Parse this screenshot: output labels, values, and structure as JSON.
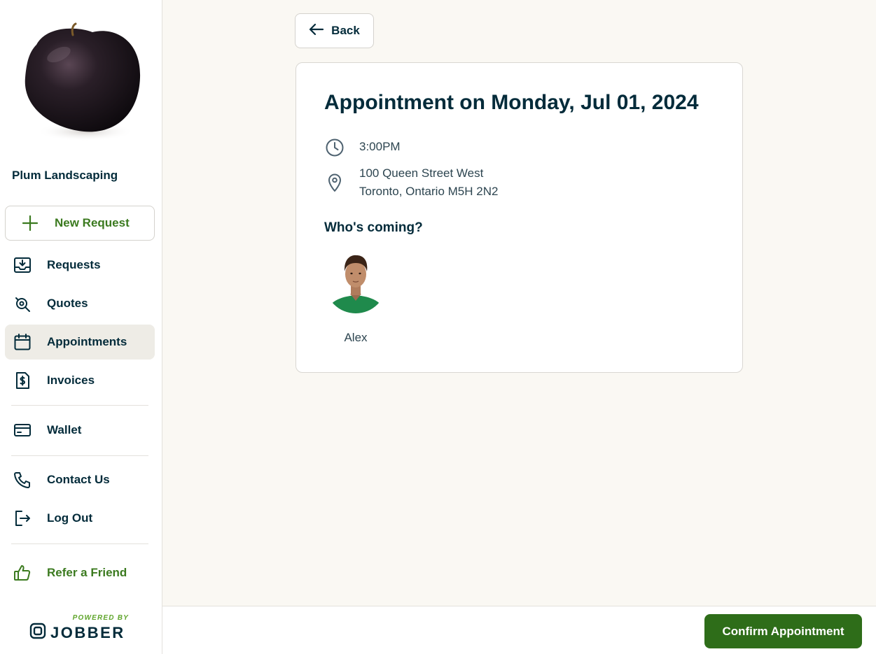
{
  "sidebar": {
    "company_name": "Plum Landscaping",
    "new_request_label": "New Request",
    "items": [
      {
        "label": "Requests",
        "icon": "inbox-download-icon"
      },
      {
        "label": "Quotes",
        "icon": "search-quote-icon"
      },
      {
        "label": "Appointments",
        "icon": "calendar-icon",
        "active": true
      },
      {
        "label": "Invoices",
        "icon": "invoice-dollar-icon"
      },
      {
        "label": "Wallet",
        "icon": "credit-card-icon"
      },
      {
        "label": "Contact Us",
        "icon": "phone-icon"
      },
      {
        "label": "Log Out",
        "icon": "logout-icon"
      },
      {
        "label": "Refer a Friend",
        "icon": "thumbs-up-icon"
      }
    ],
    "powered_by": "POWERED BY",
    "brand": "JOBBER"
  },
  "main": {
    "back_label": "Back",
    "title": "Appointment on Monday, Jul 01, 2024",
    "time": "3:00PM",
    "address_line1": "100 Queen Street West",
    "address_line2": "Toronto, Ontario M5H 2N2",
    "who_heading": "Who's coming?",
    "attendee_name": "Alex"
  },
  "footer": {
    "confirm_label": "Confirm Appointment"
  },
  "colors": {
    "accent_green": "#2e6d19",
    "text_green": "#3b7a1f",
    "navy": "#032b3a",
    "background": "#faf8f3"
  }
}
